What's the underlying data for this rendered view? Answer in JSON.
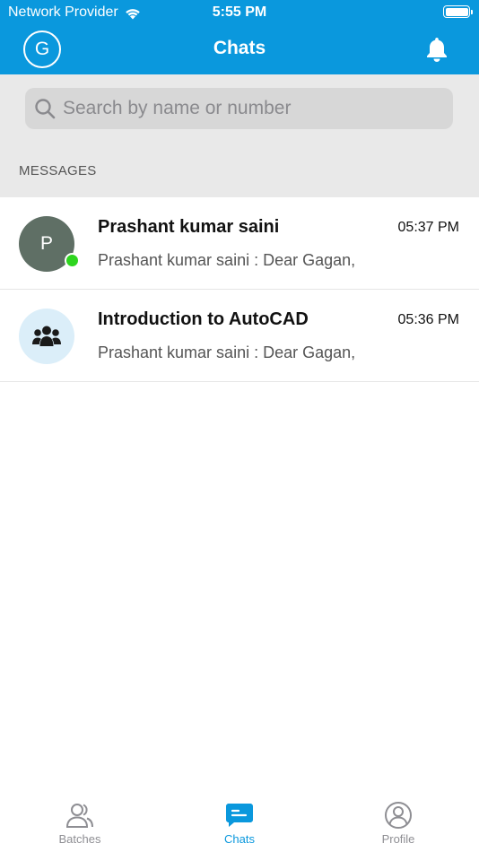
{
  "status_bar": {
    "carrier": "Network Provider",
    "time": "5:55 PM"
  },
  "header": {
    "avatar_letter": "G",
    "title": "Chats"
  },
  "search": {
    "placeholder": "Search by name or number"
  },
  "section_label": "MESSAGES",
  "chats": [
    {
      "avatar_letter": "P",
      "name": "Prashant kumar saini",
      "time": "05:37 PM",
      "preview": "Prashant kumar saini : Dear Gagan,",
      "online": true,
      "avatar_type": "letter"
    },
    {
      "avatar_letter": "",
      "name": "Introduction to AutoCAD",
      "time": "05:36 PM",
      "preview": "Prashant kumar saini : Dear Gagan,",
      "online": false,
      "avatar_type": "group-icon"
    }
  ],
  "tabs": [
    {
      "label": "Batches",
      "icon": "users-icon",
      "active": false
    },
    {
      "label": "Chats",
      "icon": "chat-icon",
      "active": true
    },
    {
      "label": "Profile",
      "icon": "profile-icon",
      "active": false
    }
  ],
  "colors": {
    "brand": "#0a98dd",
    "online": "#2ed51f",
    "inactive_tab": "#8e8e93"
  }
}
